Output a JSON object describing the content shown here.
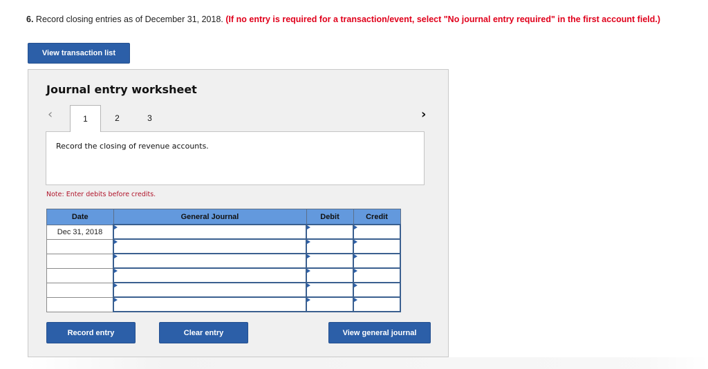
{
  "question": {
    "number": "6.",
    "text": " Record closing entries as of December 31, 2018. ",
    "instruction": "(If no entry is required for a transaction/event, select \"No journal entry required\" in the first account field.)"
  },
  "buttons": {
    "view_transaction_list": "View transaction list",
    "record_entry": "Record entry",
    "clear_entry": "Clear entry",
    "view_general_journal": "View general journal"
  },
  "worksheet": {
    "title": "Journal entry worksheet",
    "nav": {
      "prev_icon": "‹",
      "next_icon": "›"
    },
    "tabs": [
      {
        "label": "1",
        "active": true
      },
      {
        "label": "2",
        "active": false
      },
      {
        "label": "3",
        "active": false
      }
    ],
    "description": "Record the closing of revenue accounts.",
    "note": "Note: Enter debits before credits.",
    "table": {
      "headers": {
        "date": "Date",
        "account": "General Journal",
        "debit": "Debit",
        "credit": "Credit"
      },
      "rows": [
        {
          "date": "Dec 31, 2018",
          "account": "",
          "debit": "",
          "credit": ""
        },
        {
          "date": "",
          "account": "",
          "debit": "",
          "credit": ""
        },
        {
          "date": "",
          "account": "",
          "debit": "",
          "credit": ""
        },
        {
          "date": "",
          "account": "",
          "debit": "",
          "credit": ""
        },
        {
          "date": "",
          "account": "",
          "debit": "",
          "credit": ""
        },
        {
          "date": "",
          "account": "",
          "debit": "",
          "credit": ""
        }
      ]
    }
  },
  "colors": {
    "button": "#2c5fa8",
    "header": "#6399dd",
    "instruction": "#e0001b",
    "note": "#b0142a"
  }
}
